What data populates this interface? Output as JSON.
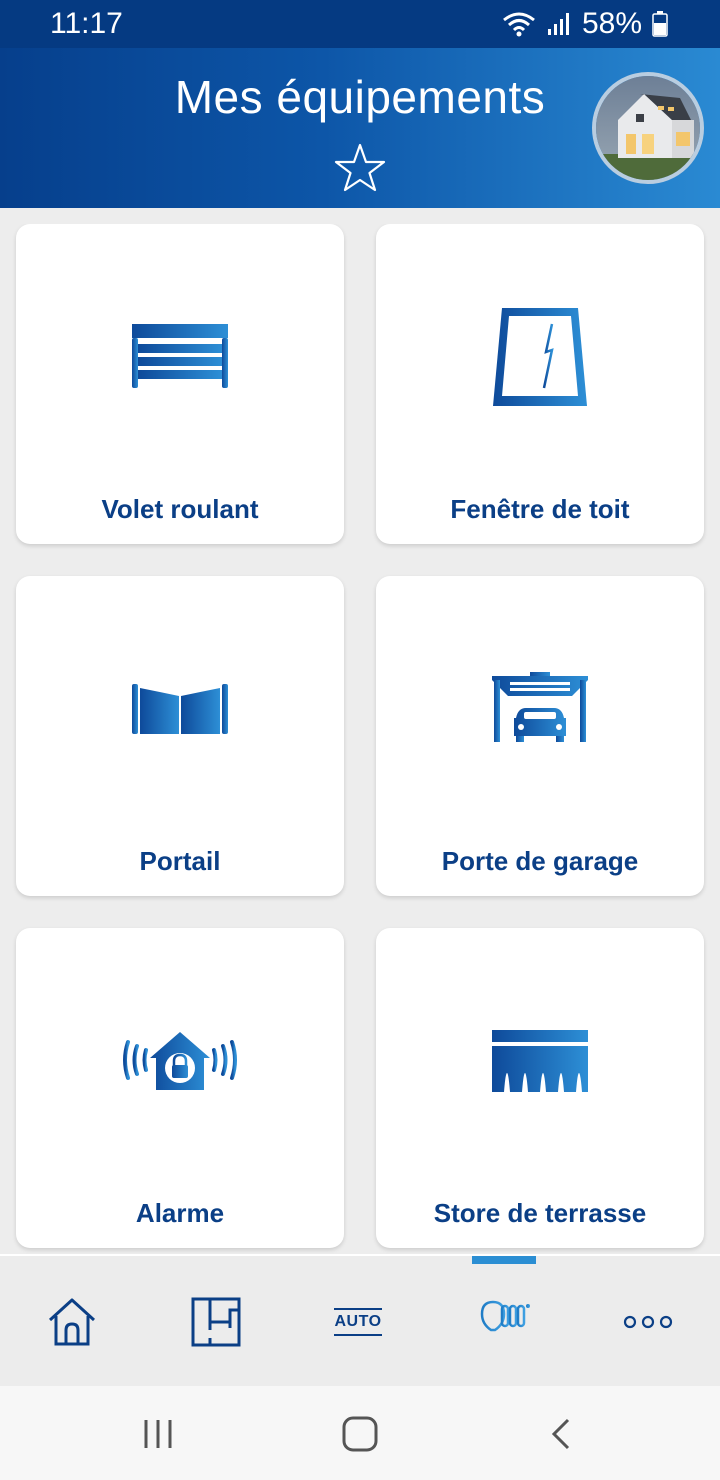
{
  "status_bar": {
    "time": "11:17",
    "battery": "58%",
    "icons": [
      "wifi-icon",
      "signal-icon",
      "battery-icon"
    ]
  },
  "header": {
    "title": "Mes équipements",
    "favorite_icon": "star-outline-icon",
    "avatar_icon": "house-photo"
  },
  "tiles": [
    {
      "label": "Volet roulant",
      "icon": "rolling-shutter-icon"
    },
    {
      "label": "Fenêtre de toit",
      "icon": "roof-window-icon"
    },
    {
      "label": "Portail",
      "icon": "gate-icon"
    },
    {
      "label": "Porte de garage",
      "icon": "garage-door-icon"
    },
    {
      "label": "Alarme",
      "icon": "alarm-house-icon"
    },
    {
      "label": "Store de terrasse",
      "icon": "awning-icon"
    }
  ],
  "bottom_nav": {
    "items": [
      {
        "icon": "home-icon"
      },
      {
        "icon": "floor-plan-icon"
      },
      {
        "icon": "auto-icon",
        "label": "AUTO"
      },
      {
        "icon": "devices-icon",
        "active": true
      },
      {
        "icon": "more-icon"
      }
    ]
  },
  "android_nav": {
    "buttons": [
      "recents-icon",
      "home-circle-icon",
      "back-icon"
    ]
  },
  "colors": {
    "primary_dark": "#0b3f86",
    "accent": "#2b8ed3",
    "status_bar": "#053a82",
    "background": "#ededed"
  }
}
